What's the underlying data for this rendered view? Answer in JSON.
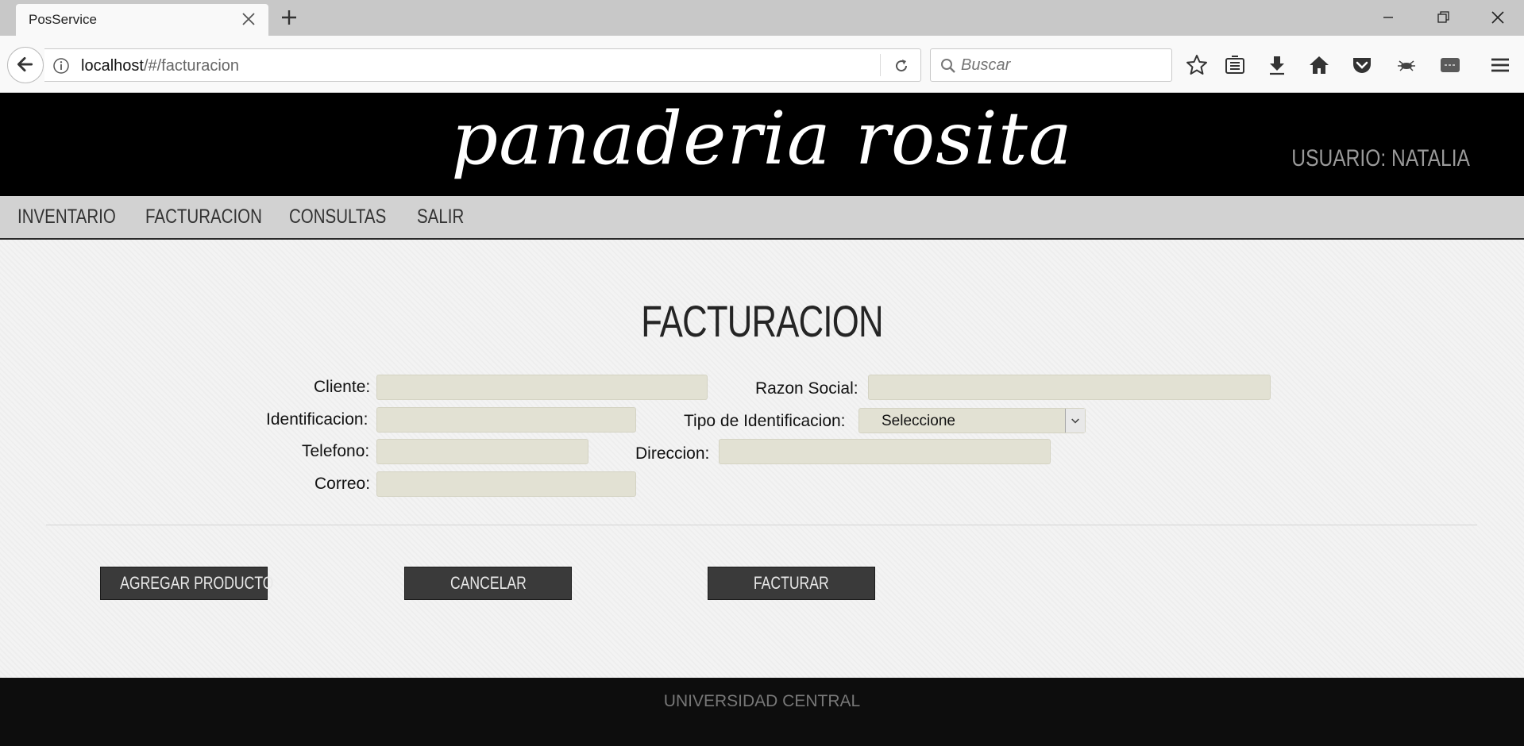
{
  "browser": {
    "tab_title": "PosService",
    "url_host": "localhost",
    "url_path": "/#/facturacion",
    "search_placeholder": "Buscar"
  },
  "header": {
    "logo_text": "panaderia rosita",
    "user_label": "USUARIO: NATALIA"
  },
  "menu": {
    "items": [
      "INVENTARIO",
      "FACTURACION",
      "CONSULTAS",
      "SALIR"
    ]
  },
  "form": {
    "title": "FACTURACION",
    "cliente_label": "Cliente:",
    "cliente_value": "",
    "razon_social_label": "Razon Social:",
    "razon_social_value": "",
    "identificacion_label": "Identificacion:",
    "identificacion_value": "",
    "tipo_identificacion_label": "Tipo de Identificacion:",
    "tipo_identificacion_selected": "Seleccione",
    "telefono_label": "Telefono:",
    "telefono_value": "",
    "direccion_label": "Direccion:",
    "direccion_value": "",
    "correo_label": "Correo:",
    "correo_value": ""
  },
  "buttons": {
    "agregar_producto": "AGREGAR PRODUCTO",
    "cancelar": "CANCELAR",
    "facturar": "FACTURAR"
  },
  "footer": {
    "text": "UNIVERSIDAD CENTRAL"
  },
  "colors": {
    "header_bg": "#000000",
    "menu_bg": "#d2d2d2",
    "input_bg": "#e2e1d3",
    "button_bg": "#3a3a3a",
    "footer_bg": "#0d0d0d"
  }
}
